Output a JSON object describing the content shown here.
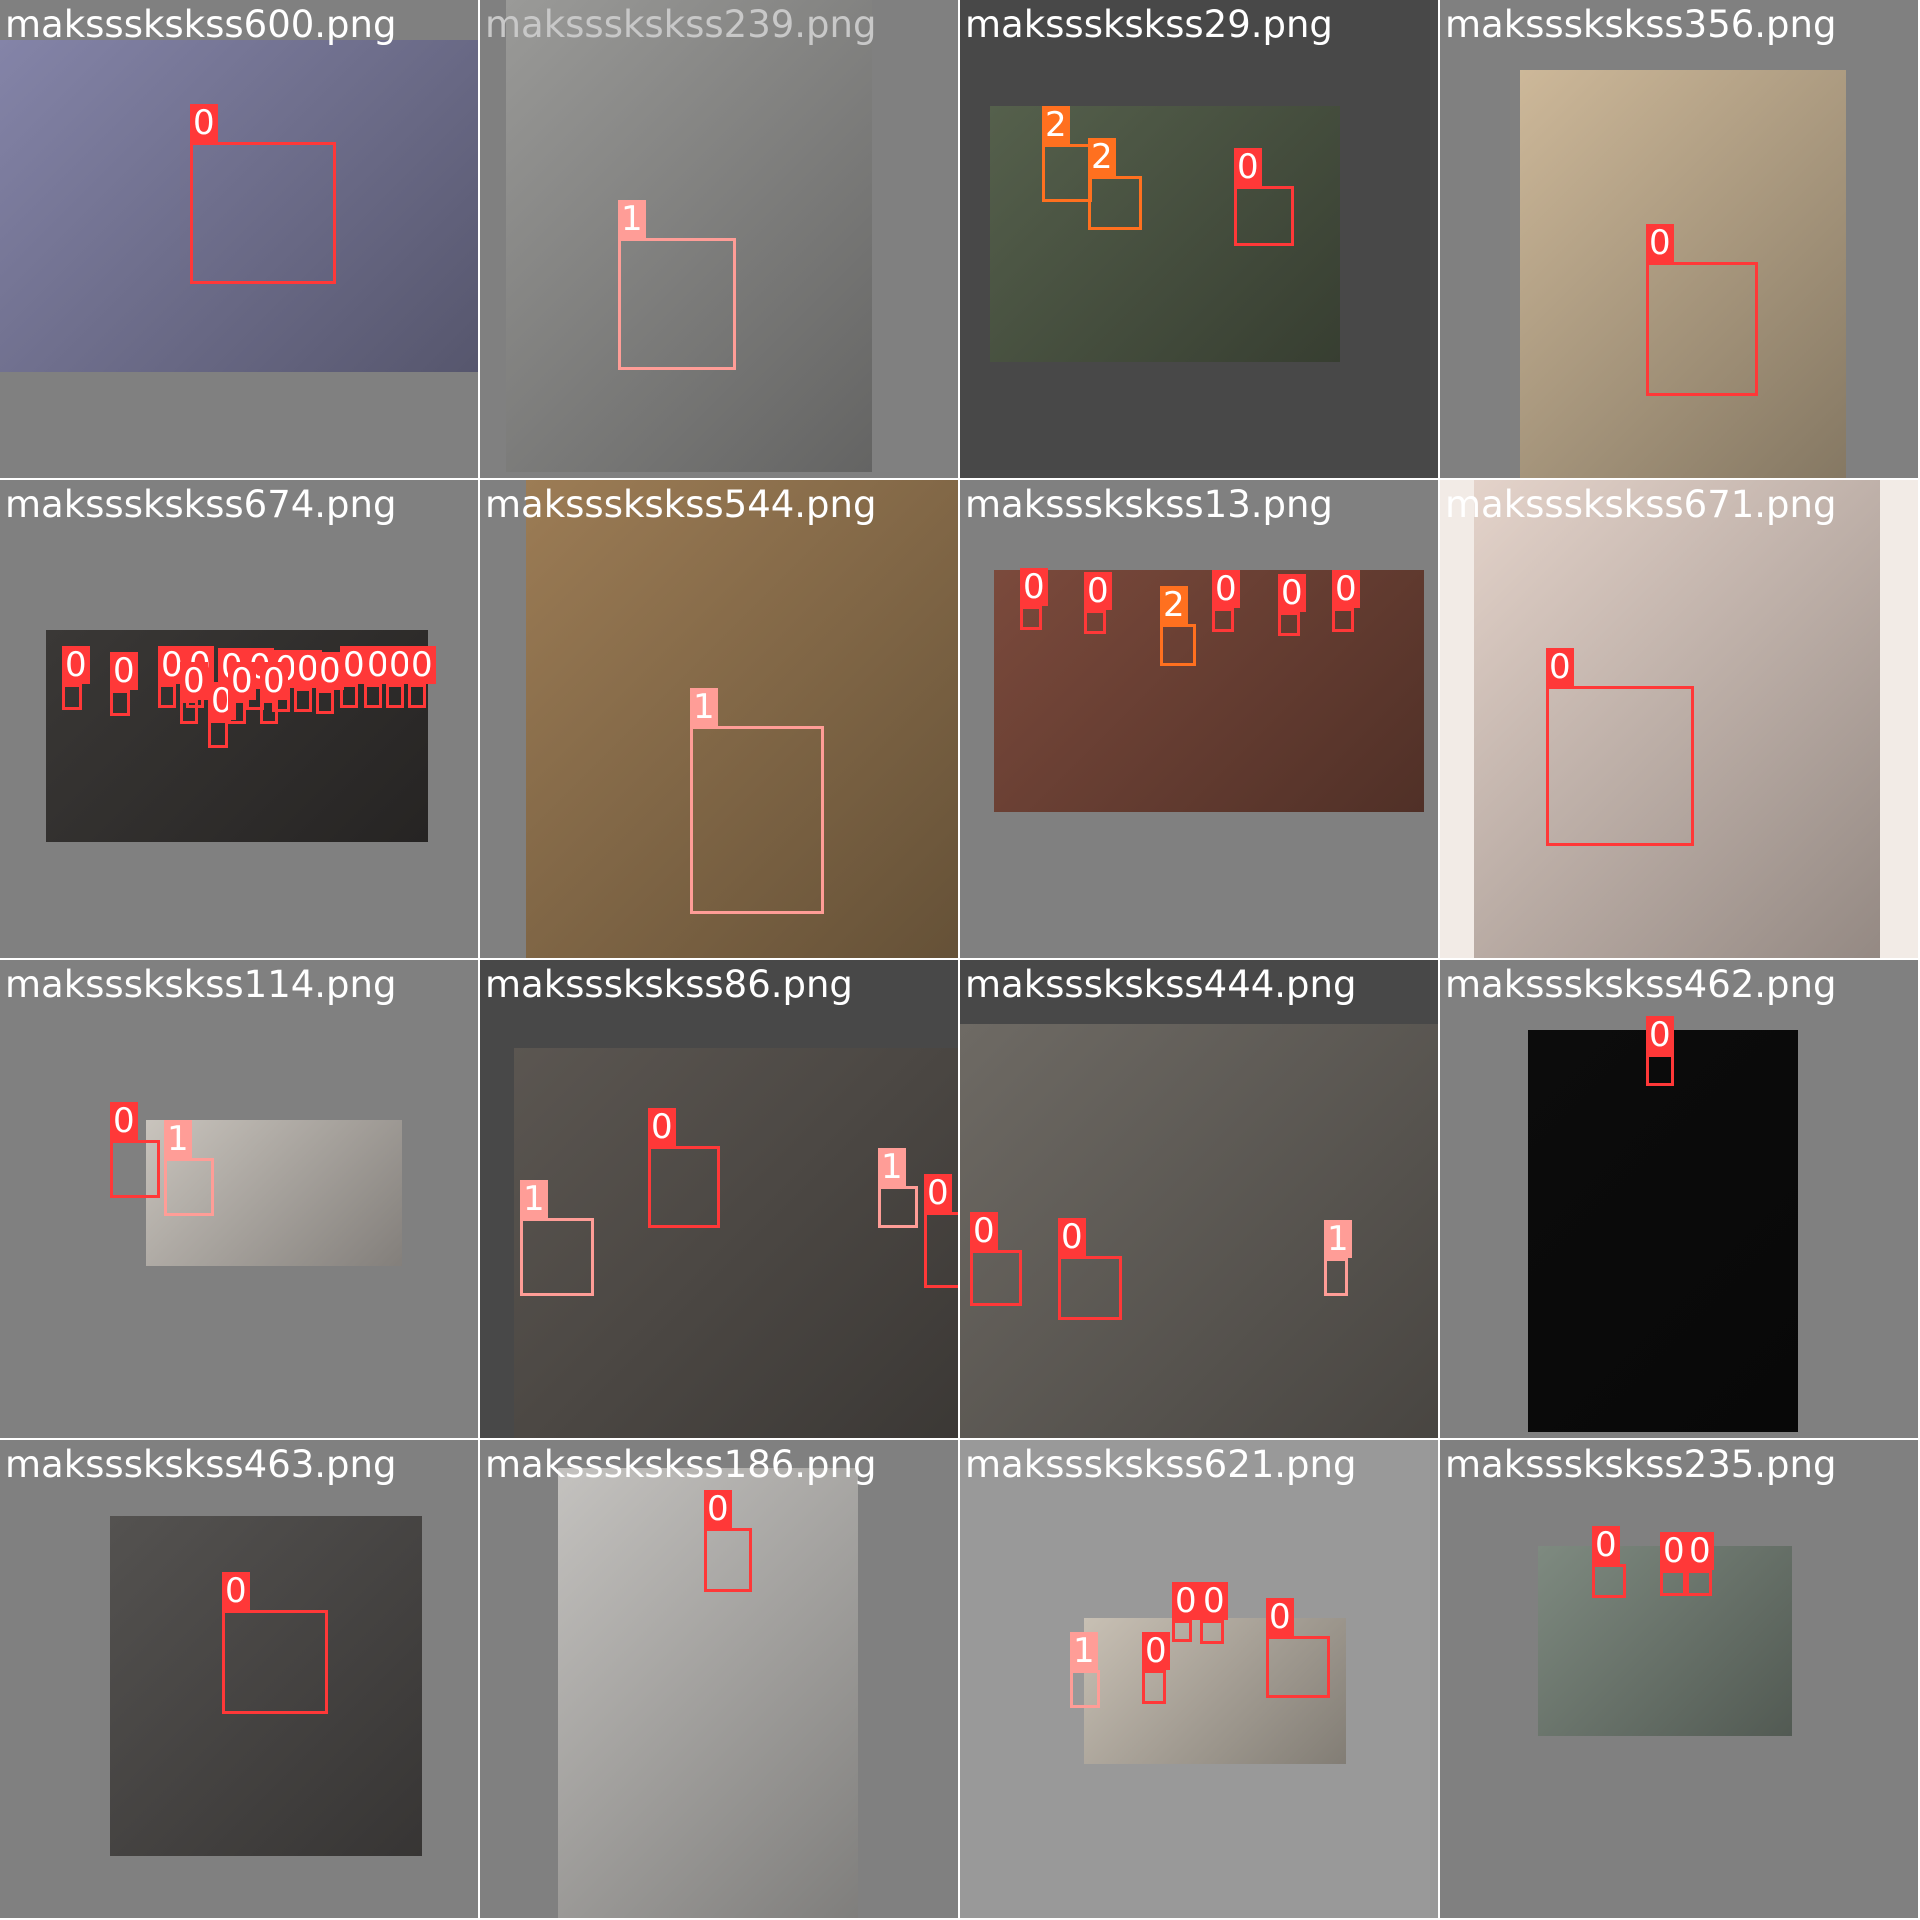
{
  "colors": {
    "tile_gray": "#808080",
    "tile_dark": "#484848",
    "tile_lite": "#999999",
    "label_on_gray": "#ffffff",
    "class_colors": {
      "0": "#ff3838",
      "1": "#ff9d97",
      "2": "#ff701f"
    }
  },
  "tiles": [
    {
      "filename": "makssskskss600.png",
      "bg": "#808080",
      "label_color": "#ffffff",
      "photo_color": "#8484a8",
      "detections": [
        {
          "cls": "0"
        }
      ]
    },
    {
      "filename": "makssskskss239.png",
      "bg": "#808080",
      "label_color": "#c8c8c8",
      "photo_color": "#9a9a98",
      "detections": [
        {
          "cls": "1"
        }
      ]
    },
    {
      "filename": "makssskskss29.png",
      "bg": "#484848",
      "label_color": "#ffffff",
      "photo_color": "#55604c",
      "detections": [
        {
          "cls": "2"
        },
        {
          "cls": "2"
        },
        {
          "cls": "0"
        }
      ]
    },
    {
      "filename": "makssskskss356.png",
      "bg": "#808080",
      "label_color": "#ffffff",
      "photo_color": "#cdb899",
      "detections": [
        {
          "cls": "0"
        }
      ]
    },
    {
      "filename": "makssskskss674.png",
      "bg": "#808080",
      "label_color": "#ffffff",
      "photo_color": "#3a3836",
      "detections": [
        {
          "cls": "0"
        },
        {
          "cls": "0"
        },
        {
          "cls": "0"
        },
        {
          "cls": "0"
        },
        {
          "cls": "0"
        },
        {
          "cls": "0"
        },
        {
          "cls": "0"
        },
        {
          "cls": "0"
        },
        {
          "cls": "0"
        },
        {
          "cls": "0"
        },
        {
          "cls": "0"
        },
        {
          "cls": "0"
        },
        {
          "cls": "0"
        },
        {
          "cls": "0"
        },
        {
          "cls": "0"
        },
        {
          "cls": "0"
        },
        {
          "cls": "0"
        }
      ]
    },
    {
      "filename": "makssskskss544.png",
      "bg": "#808080",
      "label_color": "#ffffff",
      "photo_color": "#9c7c55",
      "detections": [
        {
          "cls": "1"
        }
      ]
    },
    {
      "filename": "makssskskss13.png",
      "bg": "#808080",
      "label_color": "#ffffff",
      "photo_color": "#7b4a3c",
      "detections": [
        {
          "cls": "0"
        },
        {
          "cls": "0"
        },
        {
          "cls": "2"
        },
        {
          "cls": "0"
        },
        {
          "cls": "0"
        },
        {
          "cls": "0"
        }
      ]
    },
    {
      "filename": "makssskskss671.png",
      "bg": "#f2ebe6",
      "label_color": "#ffffff",
      "photo_color": "#e4d3ca",
      "detections": [
        {
          "cls": "0"
        }
      ]
    },
    {
      "filename": "makssskskss114.png",
      "bg": "#808080",
      "label_color": "#ffffff",
      "photo_color": "#c9c4bd",
      "detections": [
        {
          "cls": "0"
        },
        {
          "cls": "1"
        }
      ]
    },
    {
      "filename": "makssskskss86.png",
      "bg": "#484848",
      "label_color": "#ffffff",
      "photo_color": "#5b5651",
      "detections": [
        {
          "cls": "0"
        },
        {
          "cls": "1"
        },
        {
          "cls": "1"
        },
        {
          "cls": "0"
        }
      ]
    },
    {
      "filename": "makssskskss444.png",
      "bg": "#484848",
      "label_color": "#ffffff",
      "photo_color": "#6e6a64",
      "detections": [
        {
          "cls": "0"
        },
        {
          "cls": "0"
        },
        {
          "cls": "1"
        }
      ]
    },
    {
      "filename": "makssskskss462.png",
      "bg": "#808080",
      "label_color": "#ffffff",
      "photo_color": "#0c0c0c",
      "detections": [
        {
          "cls": "0"
        }
      ]
    },
    {
      "filename": "makssskskss463.png",
      "bg": "#808080",
      "label_color": "#ffffff",
      "photo_color": "#545250",
      "detections": [
        {
          "cls": "0"
        }
      ]
    },
    {
      "filename": "makssskskss186.png",
      "bg": "#808080",
      "label_color": "#ffffff",
      "photo_color": "#c4c2bf",
      "detections": [
        {
          "cls": "0"
        }
      ]
    },
    {
      "filename": "makssskskss621.png",
      "bg": "#999999",
      "label_color": "#ffffff",
      "photo_color": "#c8c0b4",
      "detections": [
        {
          "cls": "1"
        },
        {
          "cls": "0"
        },
        {
          "cls": "0"
        },
        {
          "cls": "0"
        },
        {
          "cls": "0"
        }
      ]
    },
    {
      "filename": "makssskskss235.png",
      "bg": "#808080",
      "label_color": "#ffffff",
      "photo_color": "#7e8a80",
      "detections": [
        {
          "cls": "0"
        },
        {
          "cls": "0"
        },
        {
          "cls": "0"
        }
      ]
    }
  ]
}
